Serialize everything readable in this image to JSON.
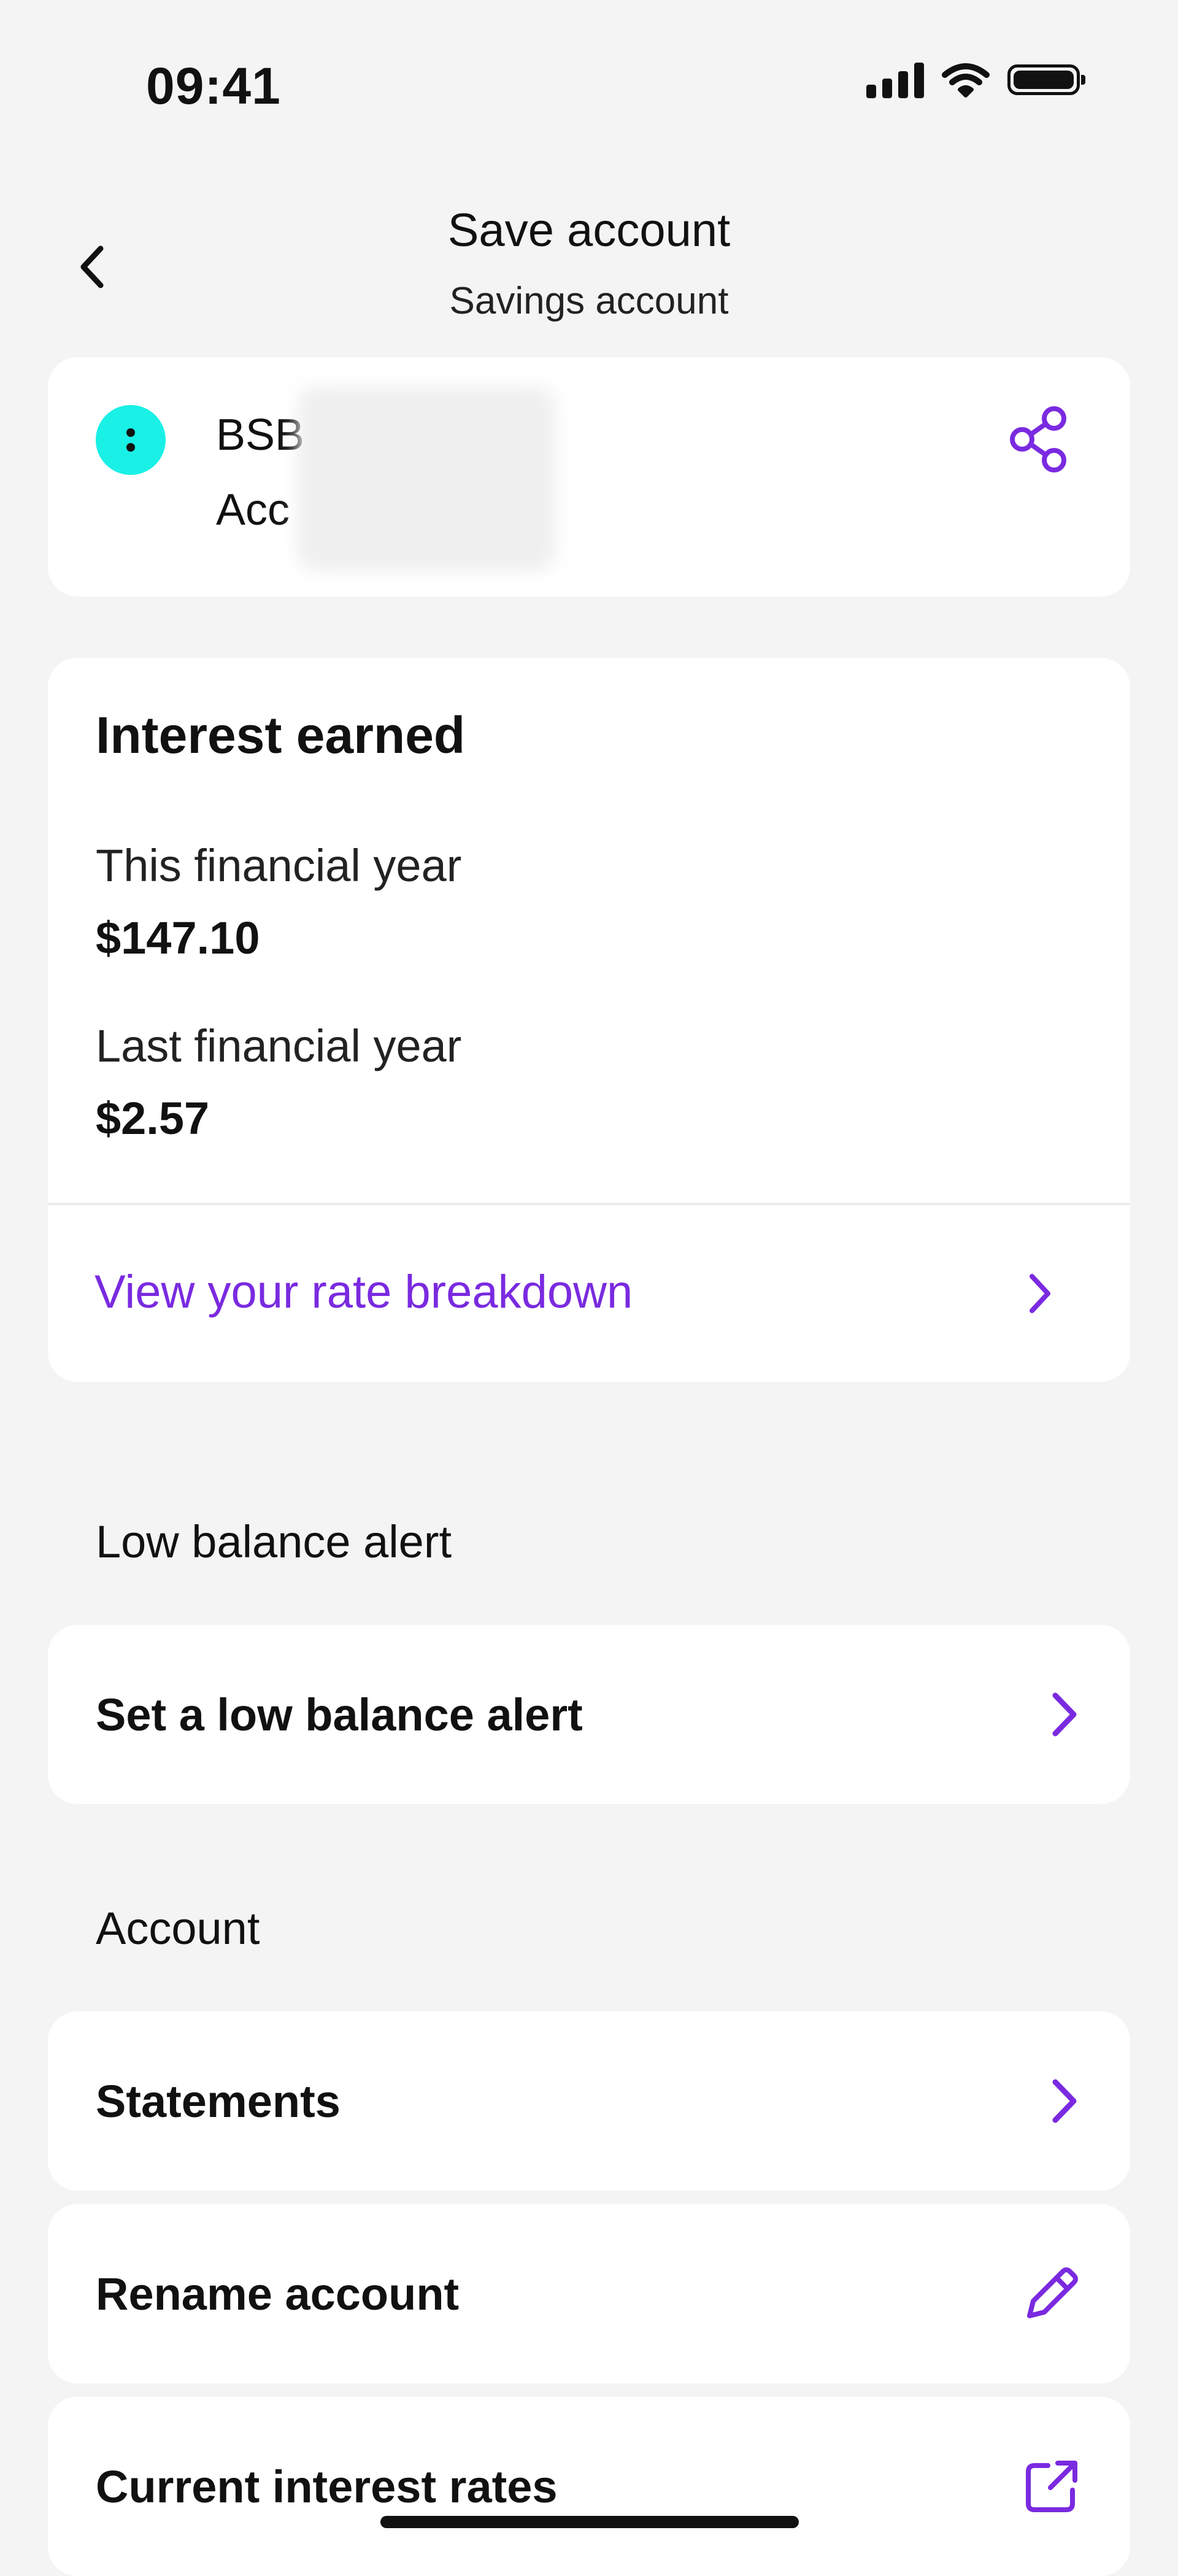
{
  "status_bar": {
    "time": "09:41"
  },
  "header": {
    "title": "Save account",
    "subtitle": "Savings account",
    "back_icon": "chevron-left-icon"
  },
  "account_card": {
    "bsb_label": "BSB",
    "account_label": "Acc",
    "share_icon": "share-icon"
  },
  "interest": {
    "title": "Interest earned",
    "this_year_label": "This financial year",
    "this_year_value": "$147.10",
    "last_year_label": "Last financial year",
    "last_year_value": "$2.57",
    "rate_link": "View your rate breakdown"
  },
  "low_balance": {
    "section_title": "Low balance alert",
    "row_label": "Set a low balance alert"
  },
  "account_section": {
    "section_title": "Account",
    "rows": [
      {
        "label": "Statements",
        "icon": "chevron-right-icon"
      },
      {
        "label": "Rename account",
        "icon": "pencil-icon"
      },
      {
        "label": "Current interest rates",
        "icon": "external-link-icon"
      }
    ]
  },
  "colors": {
    "accent": "#7a2ae0",
    "avatar": "#19f0e6",
    "background": "#f4f4f4",
    "card": "#ffffff"
  }
}
